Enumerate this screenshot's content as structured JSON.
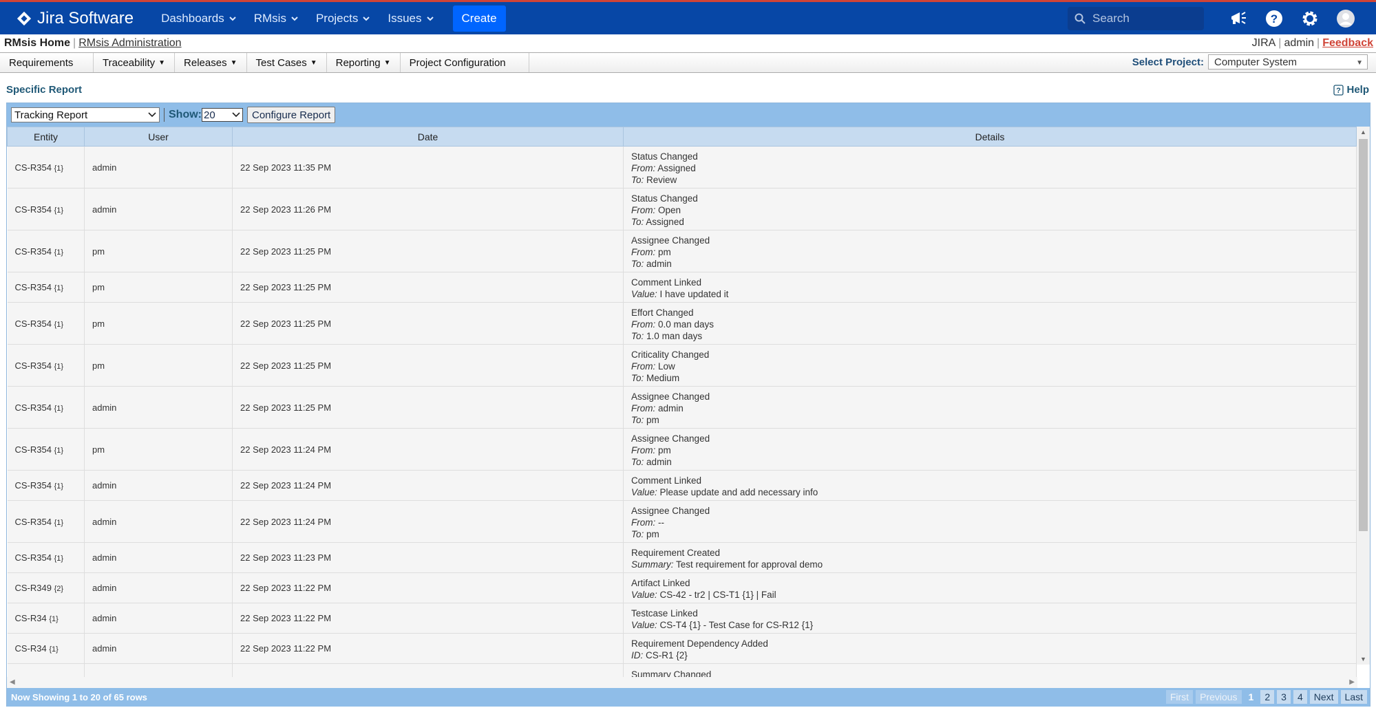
{
  "topbar": {
    "brand": "Jira Software",
    "nav": [
      "Dashboards",
      "RMsis",
      "Projects",
      "Issues"
    ],
    "create_label": "Create",
    "search_placeholder": "Search"
  },
  "rmsis": {
    "home": "RMsis Home",
    "admin": "RMsis Administration",
    "right": [
      "JIRA",
      "admin",
      "Feedback"
    ]
  },
  "menu": {
    "items": [
      {
        "label": "Requirements",
        "dropdown": false
      },
      {
        "label": "Traceability",
        "dropdown": true
      },
      {
        "label": "Releases",
        "dropdown": true
      },
      {
        "label": "Test Cases",
        "dropdown": true
      },
      {
        "label": "Reporting",
        "dropdown": true
      },
      {
        "label": "Project Configuration",
        "dropdown": false
      }
    ],
    "select_project_label": "Select Project:",
    "selected_project": "Computer System"
  },
  "report": {
    "title": "Specific Report",
    "help": "Help",
    "report_type": "Tracking Report",
    "show_label": "Show:",
    "show_value": "20",
    "configure_label": "Configure Report",
    "columns": [
      "Entity",
      "User",
      "Date",
      "Details"
    ],
    "rows": [
      {
        "entity": "CS-R354",
        "ver": "{1}",
        "user": "admin",
        "date": "22 Sep 2023 11:35 PM",
        "title": "Status Changed",
        "lines": [
          [
            "From:",
            "Assigned"
          ],
          [
            "To:",
            "Review"
          ]
        ]
      },
      {
        "entity": "CS-R354",
        "ver": "{1}",
        "user": "admin",
        "date": "22 Sep 2023 11:26 PM",
        "title": "Status Changed",
        "lines": [
          [
            "From:",
            "Open"
          ],
          [
            "To:",
            "Assigned"
          ]
        ]
      },
      {
        "entity": "CS-R354",
        "ver": "{1}",
        "user": "pm",
        "date": "22 Sep 2023 11:25 PM",
        "title": "Assignee Changed",
        "lines": [
          [
            "From:",
            "pm"
          ],
          [
            "To:",
            "admin"
          ]
        ]
      },
      {
        "entity": "CS-R354",
        "ver": "{1}",
        "user": "pm",
        "date": "22 Sep 2023 11:25 PM",
        "title": "Comment Linked",
        "lines": [
          [
            "Value:",
            "I have updated it"
          ]
        ]
      },
      {
        "entity": "CS-R354",
        "ver": "{1}",
        "user": "pm",
        "date": "22 Sep 2023 11:25 PM",
        "title": "Effort Changed",
        "lines": [
          [
            "From:",
            "0.0 man days"
          ],
          [
            "To:",
            "1.0 man days"
          ]
        ]
      },
      {
        "entity": "CS-R354",
        "ver": "{1}",
        "user": "pm",
        "date": "22 Sep 2023 11:25 PM",
        "title": "Criticality Changed",
        "lines": [
          [
            "From:",
            "Low"
          ],
          [
            "To:",
            "Medium"
          ]
        ]
      },
      {
        "entity": "CS-R354",
        "ver": "{1}",
        "user": "admin",
        "date": "22 Sep 2023 11:25 PM",
        "title": "Assignee Changed",
        "lines": [
          [
            "From:",
            "admin"
          ],
          [
            "To:",
            "pm"
          ]
        ]
      },
      {
        "entity": "CS-R354",
        "ver": "{1}",
        "user": "pm",
        "date": "22 Sep 2023 11:24 PM",
        "title": "Assignee Changed",
        "lines": [
          [
            "From:",
            "pm"
          ],
          [
            "To:",
            "admin"
          ]
        ]
      },
      {
        "entity": "CS-R354",
        "ver": "{1}",
        "user": "admin",
        "date": "22 Sep 2023 11:24 PM",
        "title": "Comment Linked",
        "lines": [
          [
            "Value:",
            "Please update and add necessary info"
          ]
        ]
      },
      {
        "entity": "CS-R354",
        "ver": "{1}",
        "user": "admin",
        "date": "22 Sep 2023 11:24 PM",
        "title": "Assignee Changed",
        "lines": [
          [
            "From:",
            "--"
          ],
          [
            "To:",
            "pm"
          ]
        ]
      },
      {
        "entity": "CS-R354",
        "ver": "{1}",
        "user": "admin",
        "date": "22 Sep 2023 11:23 PM",
        "title": "Requirement Created",
        "lines": [
          [
            "Summary:",
            "Test requirement for approval demo"
          ]
        ]
      },
      {
        "entity": "CS-R349",
        "ver": "{2}",
        "user": "admin",
        "date": "22 Sep 2023 11:22 PM",
        "title": "Artifact Linked",
        "lines": [
          [
            "Value:",
            "CS-42 - tr2 | CS-T1 {1} | Fail"
          ]
        ]
      },
      {
        "entity": "CS-R34",
        "ver": "{1}",
        "user": "admin",
        "date": "22 Sep 2023 11:22 PM",
        "title": "Testcase Linked",
        "lines": [
          [
            "Value:",
            "CS-T4 {1} - Test Case for CS-R12 {1}"
          ]
        ]
      },
      {
        "entity": "CS-R34",
        "ver": "{1}",
        "user": "admin",
        "date": "22 Sep 2023 11:22 PM",
        "title": "Requirement Dependency Added",
        "lines": [
          [
            "ID:",
            "CS-R1 {2}"
          ]
        ]
      },
      {
        "entity": "",
        "ver": "",
        "user": "",
        "date": "",
        "title": "Summary Changed",
        "lines": []
      }
    ],
    "footer": "Now Showing 1 to 20 of 65 rows",
    "pager": [
      "First",
      "Previous",
      "1",
      "2",
      "3",
      "4",
      "Next",
      "Last"
    ],
    "current_page": "1"
  }
}
